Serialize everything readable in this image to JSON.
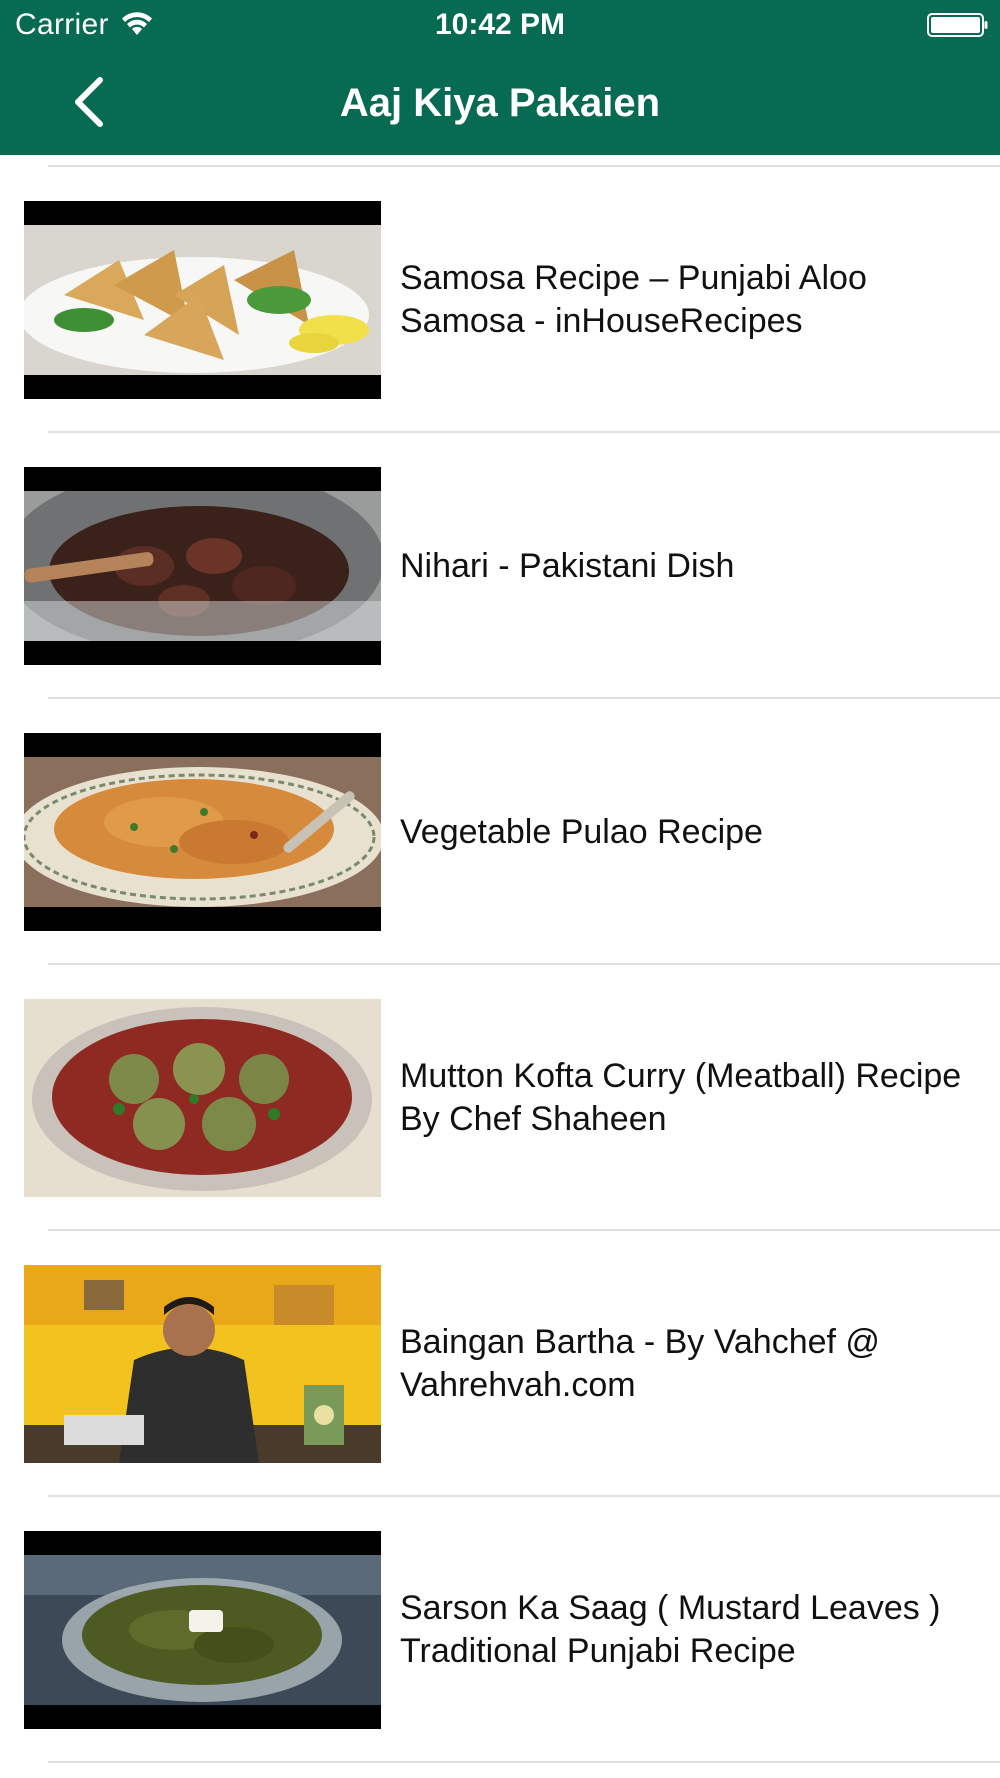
{
  "status_bar": {
    "carrier": "Carrier",
    "time": "10:42 PM",
    "wifi_icon": "wifi-icon",
    "battery_icon": "battery-icon"
  },
  "nav": {
    "title": "Aaj Kiya Pakaien",
    "back_icon": "chevron-left-icon",
    "background_color": "#076a52",
    "text_color": "#ffffff"
  },
  "videos": [
    {
      "title": "Samosa Recipe – Punjabi Aloo Samosa - inHouseRecipes",
      "thumbnail": "samosa plate with mint and lemon"
    },
    {
      "title": "Nihari - Pakistani Dish",
      "thumbnail": "nihari in cooking pot"
    },
    {
      "title": "Vegetable Pulao Recipe",
      "thumbnail": "pulao rice on plate"
    },
    {
      "title": "Mutton Kofta Curry (Meatball) Recipe By Chef Shaheen",
      "thumbnail": "kofta curry bowl"
    },
    {
      "title": "Baingan Bartha - By Vahchef @ Vahrehvah.com",
      "thumbnail": "chef in kitchen"
    },
    {
      "title": "Sarson Ka Saag ( Mustard Leaves ) Traditional Punjabi Recipe",
      "thumbnail": "saag in glass bowl"
    }
  ]
}
